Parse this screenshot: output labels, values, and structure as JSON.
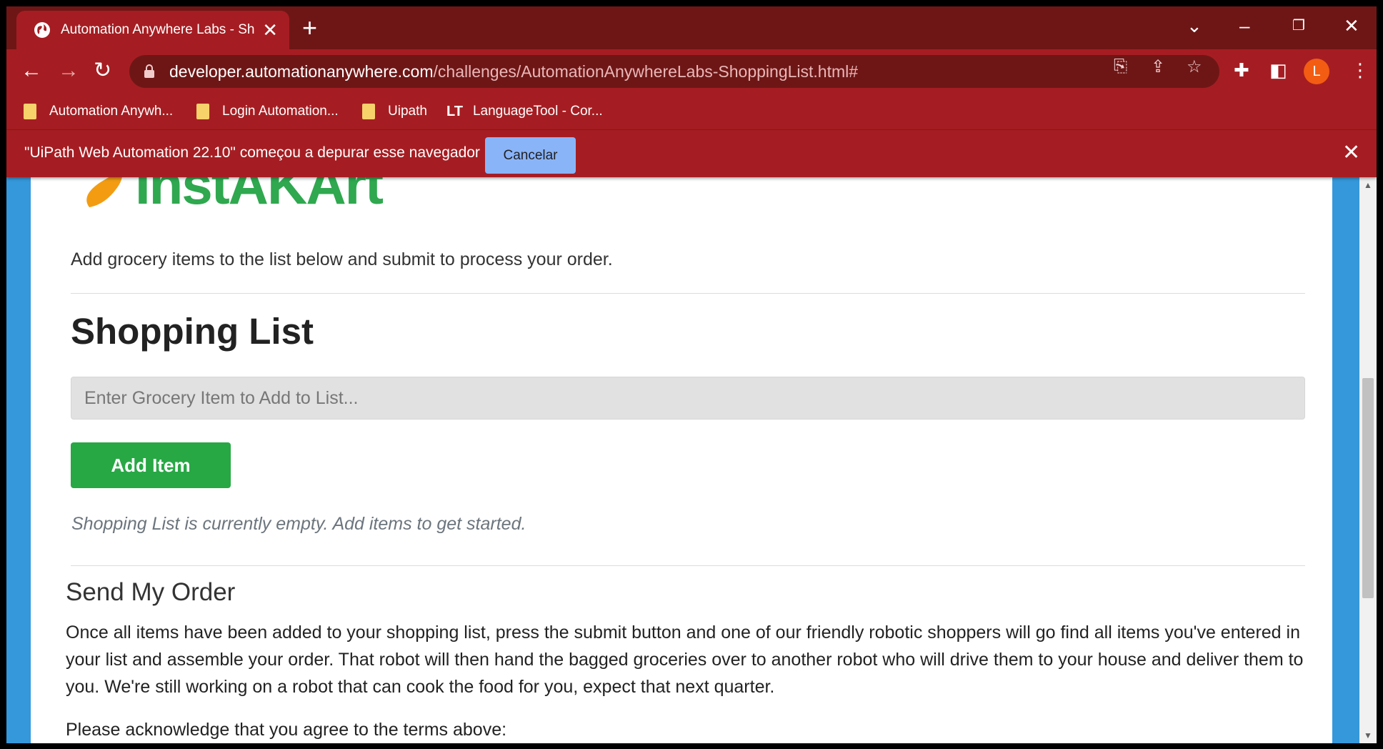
{
  "browser": {
    "tab": {
      "title": "Automation Anywhere Labs - Shopping List"
    },
    "url": {
      "host": "developer.automationanywhere.com",
      "path": "/challenges/AutomationAnywhereLabs-ShoppingList.html#"
    },
    "avatar_initial": "L",
    "icons": [
      "globe-icon",
      "close-icon",
      "plus-icon",
      "chevron-down-icon",
      "minimize-icon",
      "restore-icon",
      "back-arrow-icon",
      "forward-arrow-icon",
      "reload-icon",
      "lock-icon",
      "translate-icon",
      "share-icon",
      "star-icon",
      "puzzle-icon",
      "side-panel-icon",
      "kebab-menu-icon",
      "folder-icon"
    ],
    "bookmarks": [
      {
        "label": "Automation Anywh..."
      },
      {
        "label": "Login Automation..."
      },
      {
        "label": "Uipath"
      },
      {
        "label": "LanguageTool - Cor...",
        "icon": "LT"
      }
    ],
    "infobar": {
      "message": "\"UiPath Web Automation 22.10\" começou a depurar esse navegador",
      "cancel_label": "Cancelar"
    }
  },
  "page": {
    "logo_text": "InstAKArt",
    "intro": "Add grocery items to the list below and submit to process your order.",
    "heading": "Shopping List",
    "input_placeholder": "Enter Grocery Item to Add to List...",
    "add_button": "Add Item",
    "empty_message": "Shopping List is currently empty. Add items to get started.",
    "order_heading": "Send My Order",
    "order_text": "Once all items have been added to your shopping list, press the submit button and one of our friendly robotic shoppers will go find all items you've entered in your list and assemble your order. That robot will then hand the bagged groceries over to another robot who will drive them to your house and deliver them to you. We're still working on a robot that can cook the food for you, expect that next quarter.",
    "acknowledge": "Please acknowledge that you agree to the terms above:"
  },
  "colors": {
    "browser_frame": "#6e1616",
    "browser_toolbar": "#a51d22",
    "page_side": "#3498db",
    "add_button": "#28a745",
    "logo_green": "#2fa84f",
    "logo_orange": "#f39c12",
    "cancel_button": "#8ab4f8",
    "avatar": "#f25d13"
  }
}
